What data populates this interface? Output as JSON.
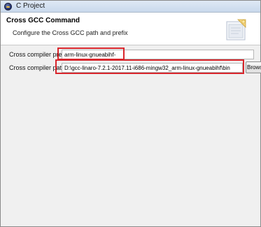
{
  "window": {
    "title": "C Project"
  },
  "banner": {
    "title": "Cross GCC Command",
    "description": "Configure the Cross GCC path and prefix",
    "icon": "wizard-folder-icon"
  },
  "form": {
    "prefix_label": "Cross compiler prefix",
    "prefix_value": "arm-linux-gnueabihf-",
    "path_label": "Cross compiler path",
    "path_value": "D:\\gcc-linaro-7.2.1-2017.11-i686-mingw32_arm-linux-gnueabihf\\bin",
    "browse_label": "Browse..."
  },
  "colors": {
    "highlight": "#d9262c",
    "banner_background": "#ffffff",
    "window_background": "#f0f0f0"
  }
}
